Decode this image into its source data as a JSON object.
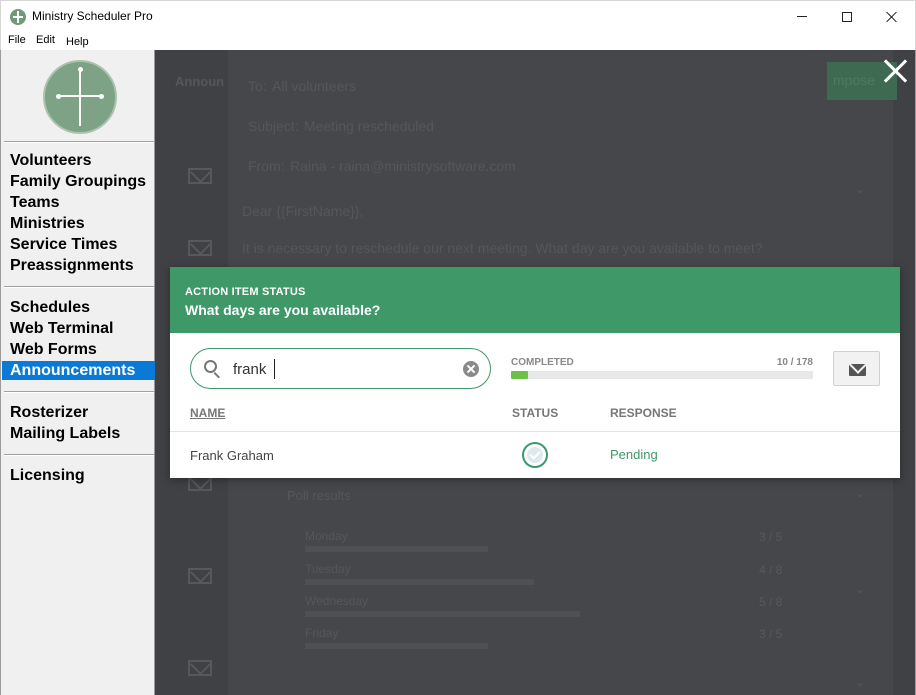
{
  "window": {
    "title": "Ministry Scheduler Pro",
    "icon": "app-clock-cross-icon"
  },
  "menu": {
    "file": "File",
    "edit": "Edit",
    "help": "Help"
  },
  "sidebar": {
    "groups": [
      [
        "Volunteers",
        "Family Groupings",
        "Teams",
        "Ministries",
        "Service Times",
        "Preassignments"
      ],
      [
        "Schedules",
        "Web Terminal",
        "Web Forms",
        "Announcements"
      ],
      [
        "Rosterizer",
        "Mailing Labels"
      ],
      [
        "Licensing"
      ]
    ],
    "active": "Announcements"
  },
  "background": {
    "tab": "Announ",
    "compose_label": "mpose",
    "to": {
      "label": "To:",
      "value": "All volunteers"
    },
    "subject": {
      "label": "Subject:",
      "value": "Meeting rescheduled"
    },
    "from": {
      "label": "From:",
      "value": "Raina - raina@ministrysoftware.com"
    },
    "greeting": "Dear {{FirstName}},",
    "body": "It is necessary to reschedule our next meeting. What day are you available to meet?",
    "poll_heading": "Poll results",
    "poll": [
      {
        "day": "Monday",
        "count": "3 / 5",
        "fraction": 0.6
      },
      {
        "day": "Tuesday",
        "count": "4 / 8",
        "fraction": 0.75
      },
      {
        "day": "Wednesday",
        "count": "5 / 8",
        "fraction": 0.9
      },
      {
        "day": "Friday",
        "count": "3 / 5",
        "fraction": 0.6
      }
    ]
  },
  "dialog": {
    "kicker": "ACTION ITEM STATUS",
    "title": "What days are you available?",
    "search": {
      "value": "frank",
      "placeholder": ""
    },
    "progress": {
      "label": "COMPLETED",
      "completed": 10,
      "total": 178,
      "display": "10 / 178"
    },
    "columns": {
      "name": "NAME",
      "status": "STATUS",
      "response": "RESPONSE"
    },
    "rows": [
      {
        "name": "Frank Graham",
        "status": "viewed",
        "response": "Pending"
      }
    ]
  },
  "colors": {
    "accent_green": "#3f9868",
    "progress_green": "#6cc04a",
    "nav_active": "#0a7ad6",
    "overlay": "#3f4144"
  }
}
